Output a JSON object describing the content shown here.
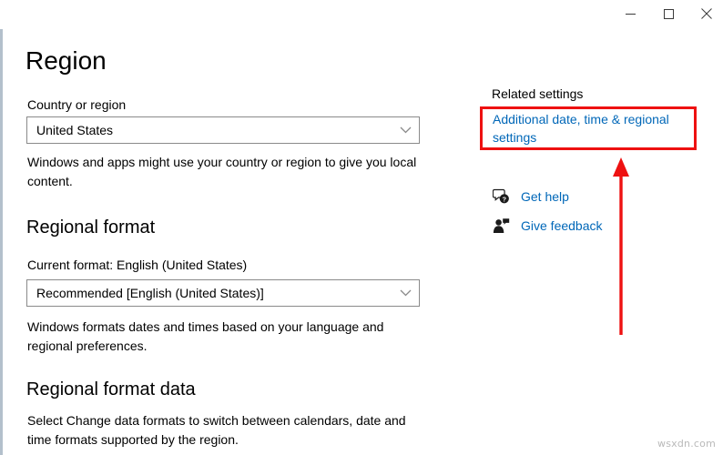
{
  "window": {
    "controls": {
      "minimize_label": "Minimize",
      "maximize_label": "Maximize",
      "close_label": "Close"
    }
  },
  "page": {
    "title": "Region"
  },
  "country_section": {
    "label": "Country or region",
    "selected_value": "United States",
    "description": "Windows and apps might use your country or region to give you local content."
  },
  "regional_format_section": {
    "heading": "Regional format",
    "current_format_label": "Current format: English (United States)",
    "selected_value": "Recommended [English (United States)]",
    "description": "Windows formats dates and times based on your language and regional preferences."
  },
  "regional_format_data_section": {
    "heading": "Regional format data",
    "description": "Select Change data formats to switch between calendars, date and time formats supported by the region."
  },
  "related_settings": {
    "title": "Related settings",
    "additional_link": "Additional date, time & regional settings",
    "get_help": "Get help",
    "give_feedback": "Give feedback"
  },
  "annotation": {
    "color": "#ee1111",
    "box_target": "Additional date, time & regional settings",
    "arrow_direction": "up"
  },
  "watermark": {
    "text": "wsxdn.com"
  },
  "colors": {
    "link": "#0067b8",
    "text": "#000000",
    "border": "#8a8a8a",
    "window_edge": "#b3c0cc",
    "annotation_red": "#ee1111"
  }
}
